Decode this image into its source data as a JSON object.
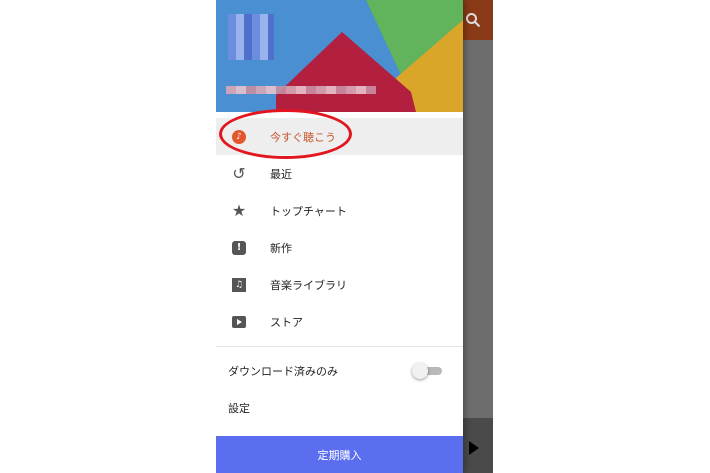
{
  "drawer": {
    "menu": [
      {
        "label": "今すぐ聴こう",
        "icon": "listen-now-icon",
        "active": true
      },
      {
        "label": "最近",
        "icon": "history-icon"
      },
      {
        "label": "トップチャート",
        "icon": "star-icon"
      },
      {
        "label": "新作",
        "icon": "new-release-icon"
      },
      {
        "label": "音楽ライブラリ",
        "icon": "library-music-icon"
      },
      {
        "label": "ストア",
        "icon": "store-icon"
      }
    ],
    "downloaded_only_label": "ダウンロード済みのみ",
    "downloaded_only_enabled": false,
    "settings_label": "設定",
    "subscribe_label": "定期購入"
  },
  "colors": {
    "accent": "#e2572b",
    "subscribe_bg": "#5b6ef0",
    "annotation": "#e1161f",
    "app_bar": "#8a3a16"
  }
}
